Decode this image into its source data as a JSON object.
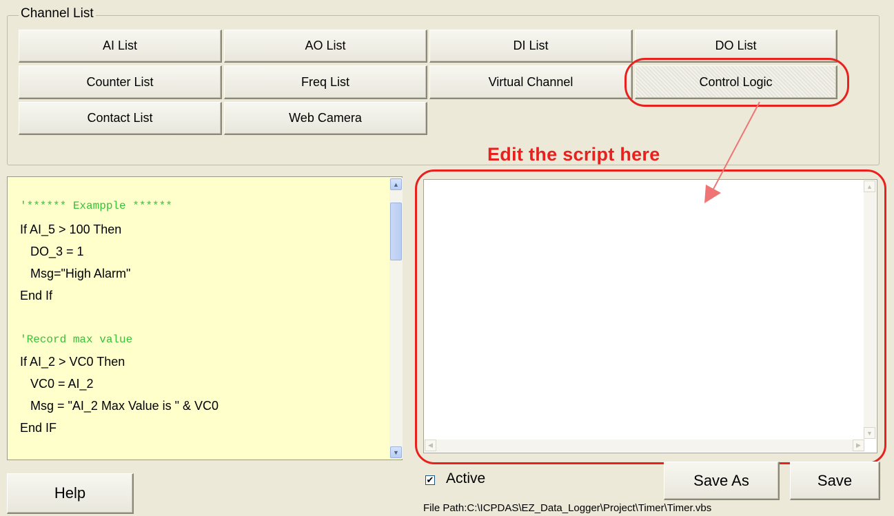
{
  "channel_list": {
    "title": "Channel List",
    "buttons": {
      "ai_list": "AI List",
      "ao_list": "AO List",
      "di_list": "DI List",
      "do_list": "DO List",
      "counter_list": "Counter List",
      "freq_list": "Freq List",
      "virtual_channel": "Virtual Channel",
      "control_logic": "Control Logic",
      "contact_list": "Contact List",
      "web_camera": "Web Camera"
    }
  },
  "annotation": {
    "text": "Edit the script here",
    "color": "#e8201e"
  },
  "script_reference": {
    "lines": [
      "'****** Exampple ******",
      "If AI_5 > 100 Then",
      "   DO_3 = 1",
      "   Msg=\"High Alarm\"",
      "End If",
      "'Record max value",
      "If AI_2 > VC0 Then",
      "   VC0 = AI_2",
      "   Msg = \"AI_2 Max Value is \" & VC0",
      "End IF"
    ],
    "background": "#ffffcc",
    "comment_color": "#38c038"
  },
  "editor": {
    "value": ""
  },
  "footer": {
    "help": "Help",
    "active_label": "Active",
    "active_checked": true,
    "active_mark": "✔",
    "save_as": "Save As",
    "save": "Save",
    "file_path": "File Path:C:\\ICPDAS\\EZ_Data_Logger\\Project\\Timer\\Timer.vbs"
  }
}
